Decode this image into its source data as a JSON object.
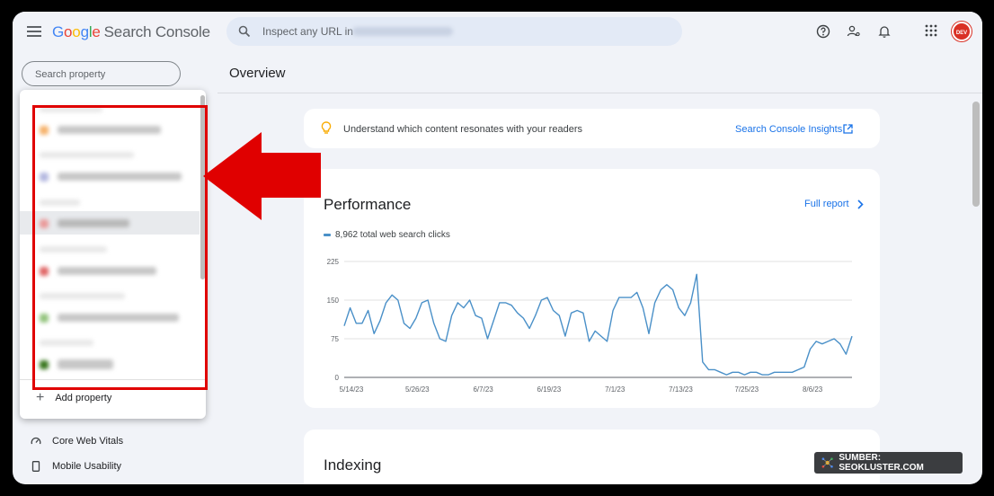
{
  "app": {
    "logo_parts": [
      "G",
      "o",
      "o",
      "g",
      "l",
      "e"
    ],
    "product_name": "Search Console"
  },
  "inspect": {
    "placeholder": "Inspect any URL in"
  },
  "search_property": {
    "placeholder": "Search property"
  },
  "page": {
    "title": "Overview"
  },
  "insights_card": {
    "text": "Understand which content resonates with your readers",
    "link_label": "Search Console Insights"
  },
  "performance": {
    "title": "Performance",
    "full_report_label": "Full report",
    "legend_label": "8,962 total web search clicks"
  },
  "indexing": {
    "title": "Indexing"
  },
  "dropdown": {
    "add_property_label": "Add property"
  },
  "sidebar": {
    "items": [
      {
        "label": "Core Web Vitals",
        "icon": "gauge-icon"
      },
      {
        "label": "Mobile Usability",
        "icon": "phone-icon"
      }
    ]
  },
  "badge": {
    "text": "SUMBER: SEOKLUSTER.COM"
  },
  "avatar": {
    "text": "DEV"
  },
  "colors": {
    "accent": "#1a73e8",
    "line": "#4a90c8",
    "highlight": "#e00000"
  },
  "chart_data": {
    "type": "line",
    "series": [
      {
        "name": "8,962 total web search clicks",
        "values": [
          100,
          135,
          105,
          105,
          130,
          85,
          110,
          145,
          160,
          150,
          105,
          95,
          115,
          145,
          150,
          105,
          75,
          70,
          120,
          145,
          135,
          150,
          120,
          115,
          75,
          110,
          145,
          145,
          140,
          125,
          115,
          95,
          120,
          150,
          155,
          130,
          120,
          80,
          125,
          130,
          125,
          70,
          90,
          80,
          70,
          130,
          155,
          155,
          155,
          165,
          135,
          85,
          145,
          170,
          180,
          170,
          135,
          120,
          145,
          200,
          30,
          15,
          15,
          10,
          5,
          10,
          10,
          5,
          10,
          10,
          5,
          5,
          10,
          10,
          10,
          10,
          15,
          20,
          55,
          70,
          65,
          70,
          75,
          65,
          45,
          80
        ]
      }
    ],
    "x_tick_labels": [
      "5/14/23",
      "5/26/23",
      "6/7/23",
      "6/19/23",
      "7/1/23",
      "7/13/23",
      "7/25/23",
      "8/6/23"
    ],
    "y_tick_labels": [
      "0",
      "75",
      "150",
      "225"
    ],
    "ylim": [
      0,
      225
    ]
  }
}
